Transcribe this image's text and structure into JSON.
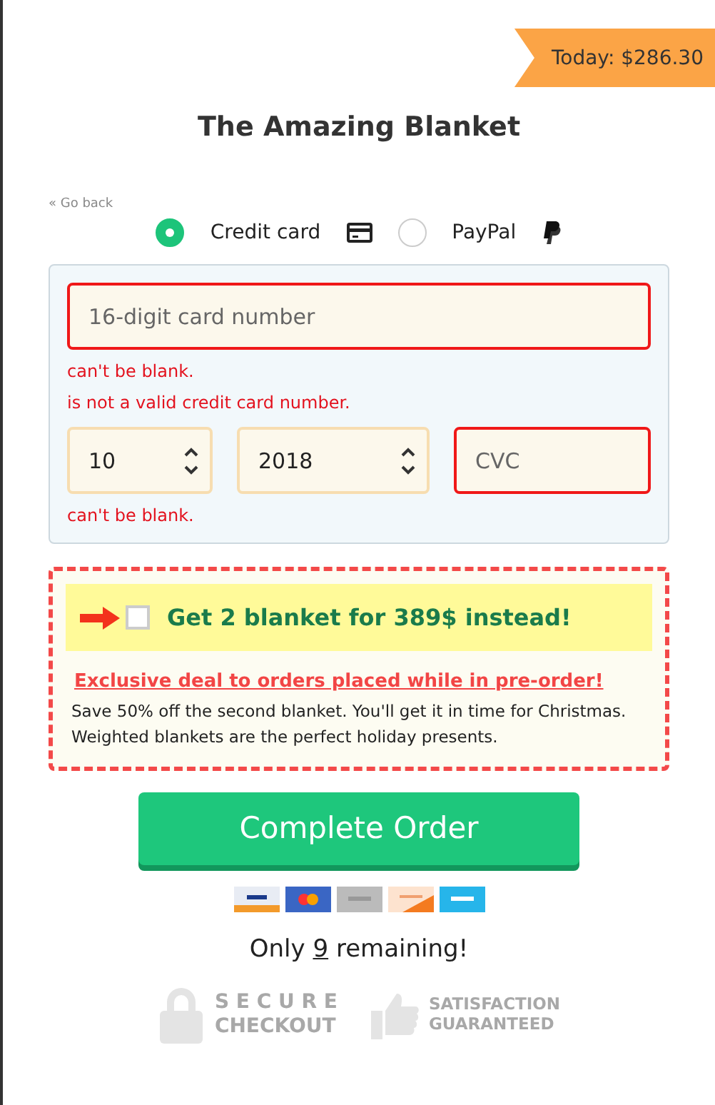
{
  "price_badge": "Today: $286.30",
  "title": "The Amazing Blanket",
  "back_link": "« Go back",
  "payment_methods": [
    {
      "label": "Credit card",
      "kind": "card",
      "selected": true
    },
    {
      "label": "PayPal",
      "kind": "paypal",
      "selected": false
    }
  ],
  "card_number": {
    "placeholder": "16-digit card number",
    "invalid": true,
    "errors": [
      "can't be blank.",
      "is not a valid credit card number."
    ]
  },
  "expiry_month": {
    "value": "10"
  },
  "expiry_year": {
    "value": "2018"
  },
  "cvc": {
    "placeholder": "CVC",
    "invalid": true
  },
  "row_errors": [
    "can't be blank."
  ],
  "upsell": {
    "label": "Get 2 blanket for 389$ instead!",
    "checked": false,
    "headline": "Exclusive deal to orders placed while in pre-order!",
    "description": "Save 50% off the second blanket. You'll get it in time for Christmas. Weighted blankets are the perfect holiday presents."
  },
  "submit_button": "Complete Order",
  "stock": {
    "prefix": "Only",
    "count": "9",
    "suffix": "remaining!"
  },
  "trust_badges": [
    {
      "kind": "lock",
      "lines": [
        "S E C U R E",
        "CHECKOUT"
      ]
    },
    {
      "kind": "thumb",
      "lines": [
        "SATISFACTION",
        "GUARANTEED"
      ]
    }
  ]
}
